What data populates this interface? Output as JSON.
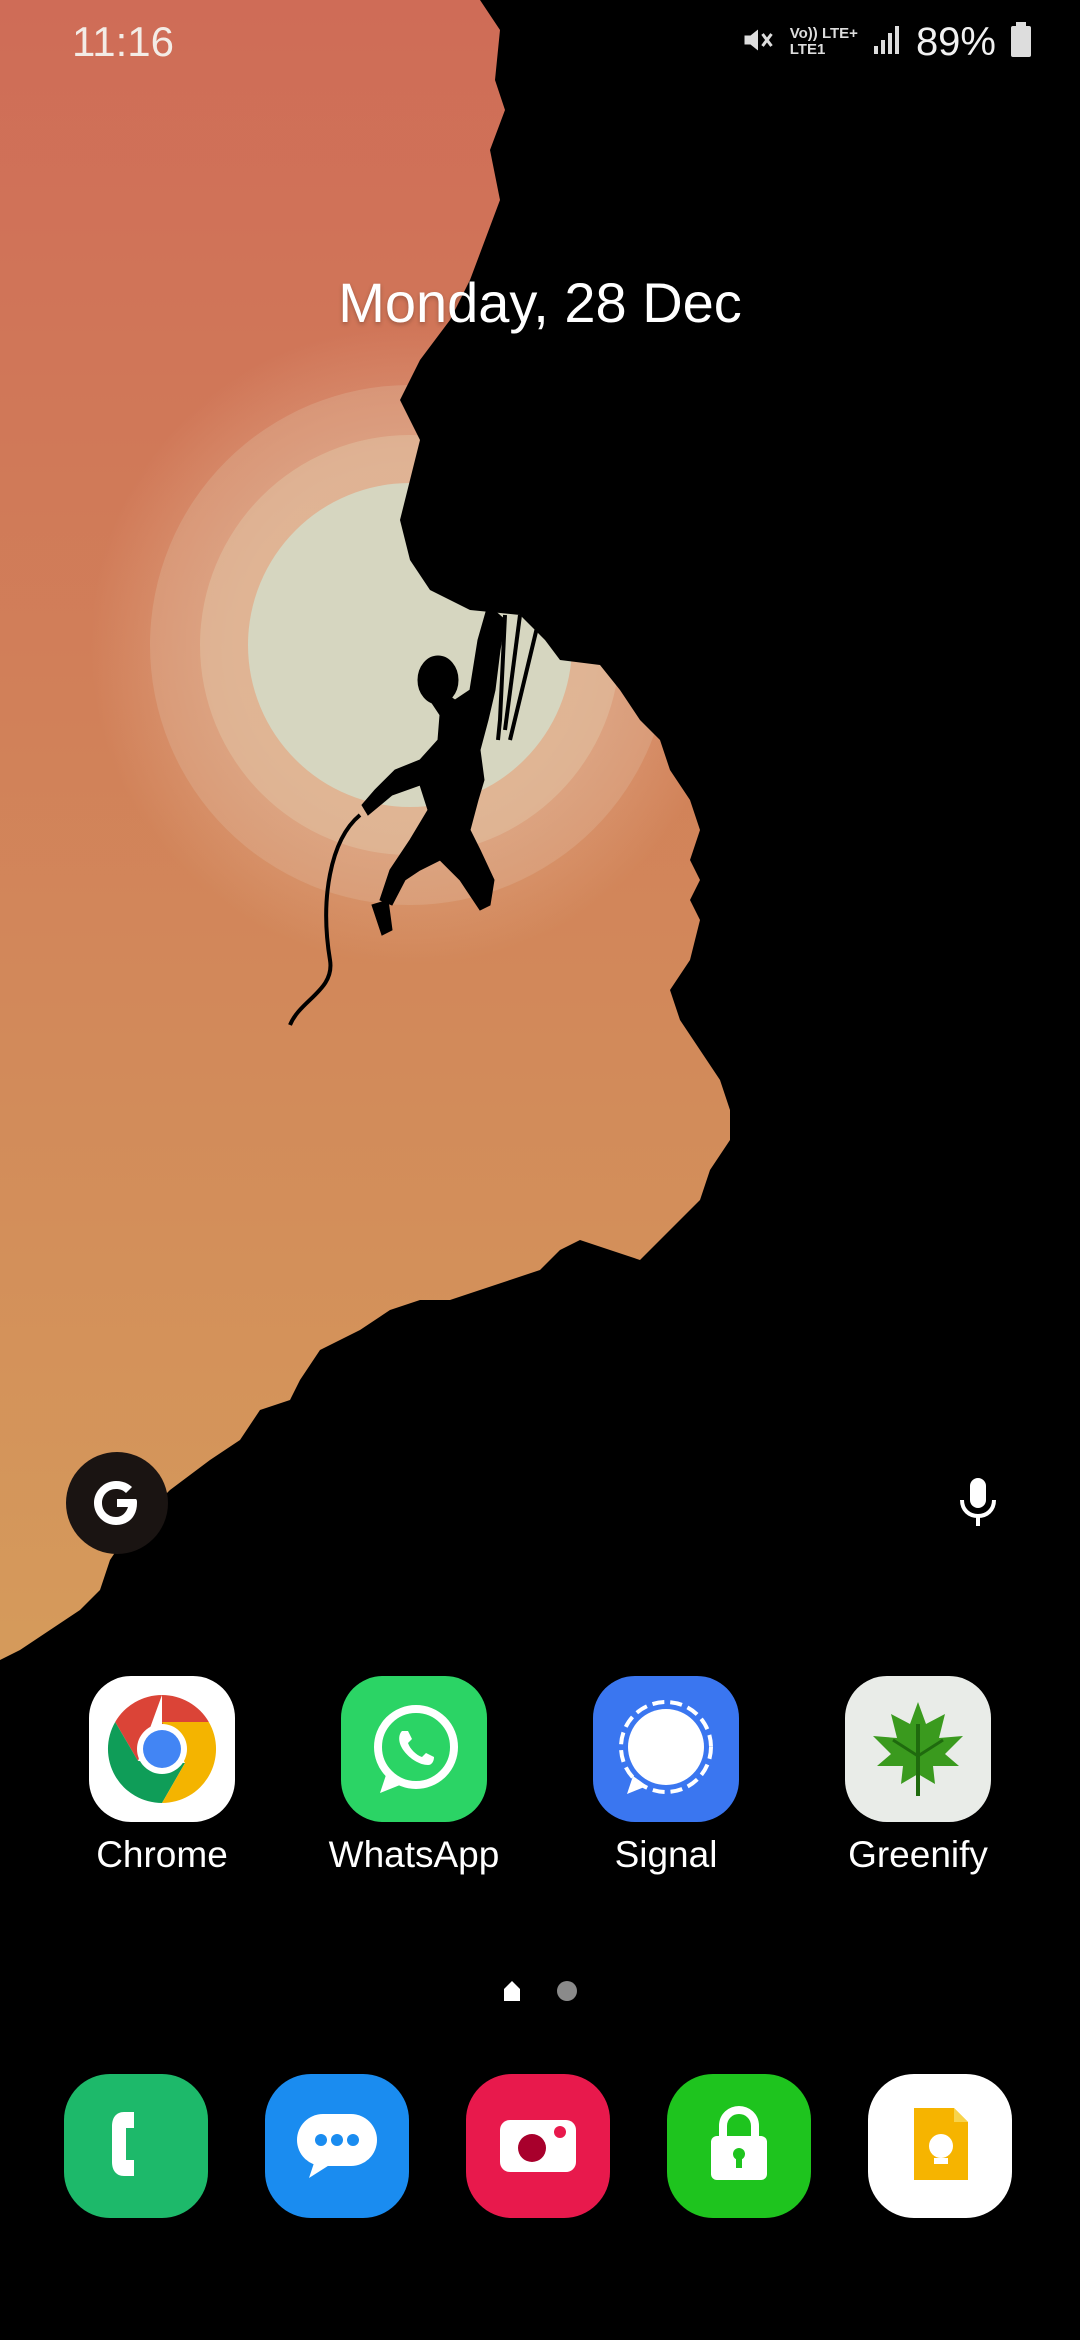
{
  "status_bar": {
    "time": "11:16",
    "net_top": "Vo)) LTE+",
    "net_bottom": "LTE1",
    "battery": "89%"
  },
  "date_widget": {
    "text": "Monday, 28 Dec"
  },
  "apps": [
    {
      "label": "Chrome"
    },
    {
      "label": "WhatsApp"
    },
    {
      "label": "Signal"
    },
    {
      "label": "Greenify"
    }
  ],
  "page_indicator": {
    "pages": 2,
    "current": 1
  },
  "colors": {
    "sky_top": "#cf6e57",
    "sky_bottom": "#d8a85c",
    "sun": "#d8d7bf",
    "phone": "#1dba6a",
    "messages": "#1a8cf0",
    "camera": "#e8194c",
    "lock": "#1ec41e",
    "keep": "#ffffff"
  }
}
